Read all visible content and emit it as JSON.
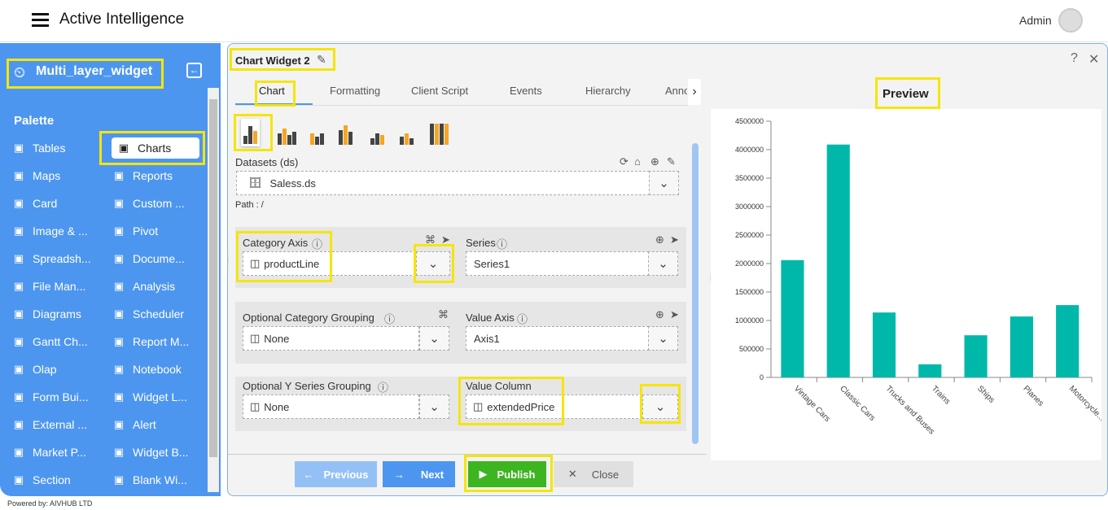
{
  "app": {
    "title": "Active Intelligence",
    "user": "Admin",
    "powered_by": "Powered by: AIVHUB LTD"
  },
  "sidebar": {
    "widget_name": "Multi_layer_widget",
    "palette_label": "Palette",
    "items": [
      {
        "label": "Tables",
        "icon": "table-icon"
      },
      {
        "label": "Charts",
        "icon": "chart-icon",
        "active": true
      },
      {
        "label": "Maps",
        "icon": "map-icon"
      },
      {
        "label": "Reports",
        "icon": "report-icon"
      },
      {
        "label": "Card",
        "icon": "card-icon"
      },
      {
        "label": "Custom ...",
        "icon": "braces-icon"
      },
      {
        "label": "Image & ...",
        "icon": "image-icon"
      },
      {
        "label": "Pivot",
        "icon": "pivot-icon"
      },
      {
        "label": "Spreadsh...",
        "icon": "excel-icon"
      },
      {
        "label": "Docume...",
        "icon": "word-icon"
      },
      {
        "label": "File Man...",
        "icon": "folder-icon"
      },
      {
        "label": "Analysis",
        "icon": "analysis-icon"
      },
      {
        "label": "Diagrams",
        "icon": "diagram-icon"
      },
      {
        "label": "Scheduler",
        "icon": "sliders-icon"
      },
      {
        "label": "Gantt Ch...",
        "icon": "gantt-icon"
      },
      {
        "label": "Report M...",
        "icon": "clipboard-icon"
      },
      {
        "label": "Olap",
        "icon": "cubes-icon"
      },
      {
        "label": "Notebook",
        "icon": "rx-icon"
      },
      {
        "label": "Form Bui...",
        "icon": "form-icon"
      },
      {
        "label": "Widget L...",
        "icon": "layers-icon"
      },
      {
        "label": "External ...",
        "icon": "grid-plus-icon"
      },
      {
        "label": "Alert",
        "icon": "alarm-icon"
      },
      {
        "label": "Market P...",
        "icon": "cloud-upload-icon"
      },
      {
        "label": "Widget B...",
        "icon": "cart-icon"
      },
      {
        "label": "Section",
        "icon": "section-icon"
      },
      {
        "label": "Blank Wi...",
        "icon": "blank-icon"
      }
    ]
  },
  "editor": {
    "title": "Chart Widget 2",
    "tabs": [
      "Chart",
      "Formatting",
      "Client Script",
      "Events",
      "Hierarchy",
      "Anno"
    ],
    "datasets_label": "Datasets (ds)",
    "dataset_value": "Saless.ds",
    "path": "Path : /",
    "category_axis_label": "Category Axis",
    "category_axis_value": "productLine",
    "series_label": "Series",
    "series_value": "Series1",
    "cat_group_label": "Optional Category Grouping",
    "cat_group_value": "None",
    "value_axis_label": "Value Axis",
    "value_axis_value": "Axis1",
    "y_group_label": "Optional Y Series Grouping",
    "y_group_value": "None",
    "value_column_label": "Value Column",
    "value_column_value": "extendedPrice",
    "buttons": {
      "previous": "Previous",
      "next": "Next",
      "publish": "Publish",
      "close": "Close"
    }
  },
  "preview": {
    "title": "Preview"
  },
  "colors": {
    "sidebar": "#4d96f0",
    "bar": "#00b8a9",
    "publish": "#3cb521",
    "next": "#4d96f0"
  },
  "chart_data": {
    "type": "bar",
    "categories": [
      "Vintage Cars",
      "Classic Cars",
      "Trucks and Buses",
      "Trains",
      "Ships",
      "Planes",
      "Motorcycle..."
    ],
    "values": [
      2060000,
      4090000,
      1140000,
      230000,
      740000,
      1070000,
      1270000
    ],
    "yticks": [
      "0",
      "500000",
      "1000000",
      "1500000",
      "2000000",
      "2500000",
      "3000000",
      "3500000",
      "4000000",
      "4500000"
    ],
    "ylim": [
      0,
      4500000
    ],
    "grid": false
  }
}
